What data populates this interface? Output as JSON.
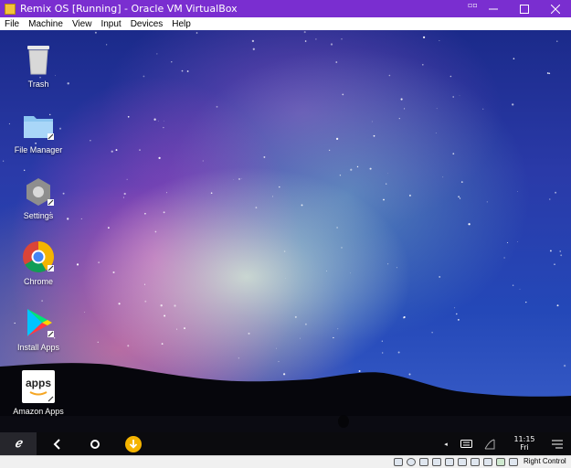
{
  "window": {
    "title": "Remix OS [Running] - Oracle VM VirtualBox",
    "minimize_icon": "minimize-icon",
    "maximize_icon": "maximize-icon",
    "close_icon": "close-icon",
    "title_color": "#7a2ed0"
  },
  "menu": [
    "File",
    "Machine",
    "View",
    "Input",
    "Devices",
    "Help"
  ],
  "desktop": {
    "icons": [
      {
        "label": "Trash",
        "icon": "trash-icon"
      },
      {
        "label": "File Manager",
        "icon": "folder-icon"
      },
      {
        "label": "Settings",
        "icon": "settings-icon"
      },
      {
        "label": "Chrome",
        "icon": "chrome-icon"
      },
      {
        "label": "Install Apps",
        "icon": "play-store-icon"
      },
      {
        "label": "Amazon Apps",
        "icon": "amazon-apps-icon",
        "text": "apps"
      }
    ]
  },
  "taskbar": {
    "start_icon": "remix-logo-icon",
    "back_icon": "back-icon",
    "home_icon": "home-icon",
    "download_icon": "download-icon",
    "accent": "#f5b400",
    "clock": {
      "time": "11:15",
      "day": "Fri"
    }
  },
  "statusbar": {
    "host_key": "Right Control"
  }
}
